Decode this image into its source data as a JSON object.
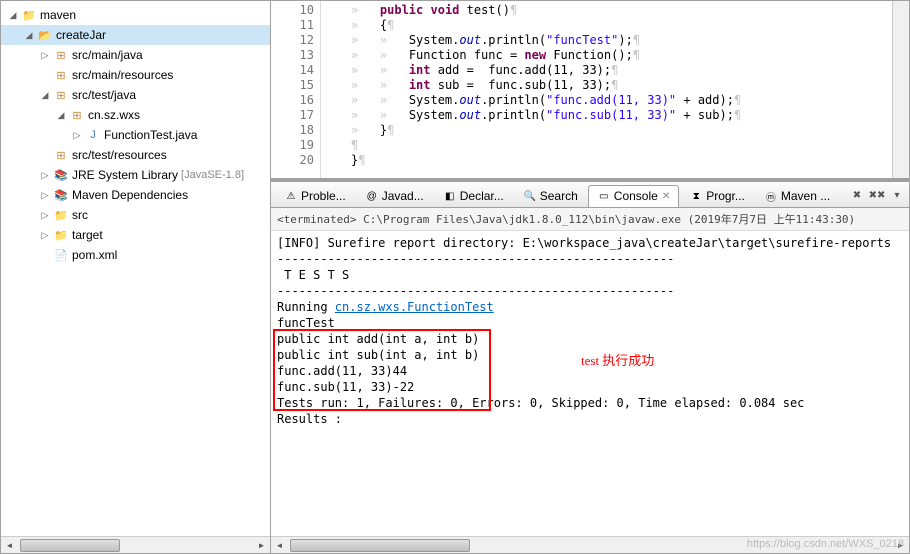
{
  "tree": {
    "root": "maven",
    "project": "createJar",
    "srcMainJava": "src/main/java",
    "srcMainRes": "src/main/resources",
    "srcTestJava": "src/test/java",
    "pkg": "cn.sz.wxs",
    "testFile": "FunctionTest.java",
    "srcTestRes": "src/test/resources",
    "jre": "JRE System Library",
    "jreSuffix": "[JavaSE-1.8]",
    "mavenDeps": "Maven Dependencies",
    "src": "src",
    "target": "target",
    "pom": "pom.xml"
  },
  "code": {
    "lines": [
      {
        "n": "10",
        "html": "    public void test()"
      },
      {
        "n": "11",
        "html": "    {"
      },
      {
        "n": "12",
        "html": "        System.out.println(\"funcTest\");"
      },
      {
        "n": "13",
        "html": "        Function func = new Function();"
      },
      {
        "n": "14",
        "html": "        int add =  func.add(11, 33);"
      },
      {
        "n": "15",
        "html": "        int sub =  func.sub(11, 33);"
      },
      {
        "n": "16",
        "html": "        System.out.println(\"func.add(11, 33)\" + add);"
      },
      {
        "n": "17",
        "html": "        System.out.println(\"func.sub(11, 33)\" + sub);"
      },
      {
        "n": "18",
        "html": "    }"
      },
      {
        "n": "19",
        "html": ""
      },
      {
        "n": "20",
        "html": "}"
      }
    ]
  },
  "tabs": {
    "problems": "Proble...",
    "javadoc": "Javad...",
    "declaration": "Declar...",
    "search": "Search",
    "console": "Console",
    "progress": "Progr...",
    "maven": "Maven ..."
  },
  "console": {
    "header": "<terminated> C:\\Program Files\\Java\\jdk1.8.0_112\\bin\\javaw.exe (2019年7月7日 上午11:43:30)",
    "lines": [
      "[INFO] Surefire report directory: E:\\workspace_java\\createJar\\target\\surefire-reports",
      "",
      "-------------------------------------------------------",
      " T E S T S",
      "-------------------------------------------------------",
      "Running ",
      "funcTest",
      "public int add(int a, int b)",
      "public int sub(int a, int b)",
      "func.add(11, 33)44",
      "func.sub(11, 33)-22",
      "Tests run: 1, Failures: 0, Errors: 0, Skipped: 0, Time elapsed: 0.084 sec",
      "",
      "Results :"
    ],
    "link": "cn.sz.wxs.FunctionTest",
    "annotation": "test 执行成功"
  },
  "watermark": "https://blog.csdn.net/WXS_0218"
}
